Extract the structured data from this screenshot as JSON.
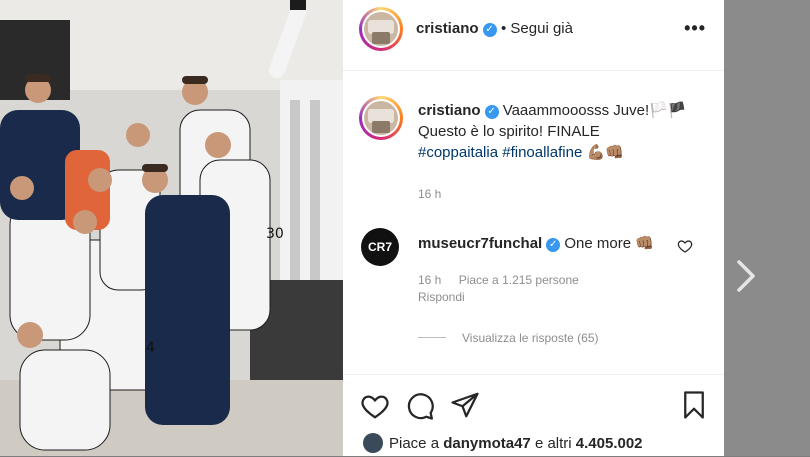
{
  "post": {
    "username": "cristiano",
    "follow_status": "Segui già",
    "more_icon": "•••",
    "caption": {
      "line1": "Vaaammooosss Juve!🏳️🏴",
      "line2": "Questo è lo spirito! FINALE",
      "hashtags": "#coppaitalia #finoallafine",
      "emoji": "💪🏽👊🏽",
      "time": "16 h"
    },
    "comment": {
      "username": "museucr7funchal",
      "avatar_text": "CR7",
      "text": "One more 👊🏽",
      "time": "16 h",
      "likes": "Piace a 1.215 persone",
      "reply": "Rispondi",
      "view_replies": "Visualizza le risposte (65)"
    },
    "likes": {
      "prefix": "Piace a",
      "user": "danymota47",
      "middle": "e altri",
      "count": "4.405.002"
    }
  },
  "colors": {
    "accent_blue": "#3897f0",
    "hashtag": "#00376b",
    "text": "#262626",
    "muted": "#8e8e8e"
  }
}
